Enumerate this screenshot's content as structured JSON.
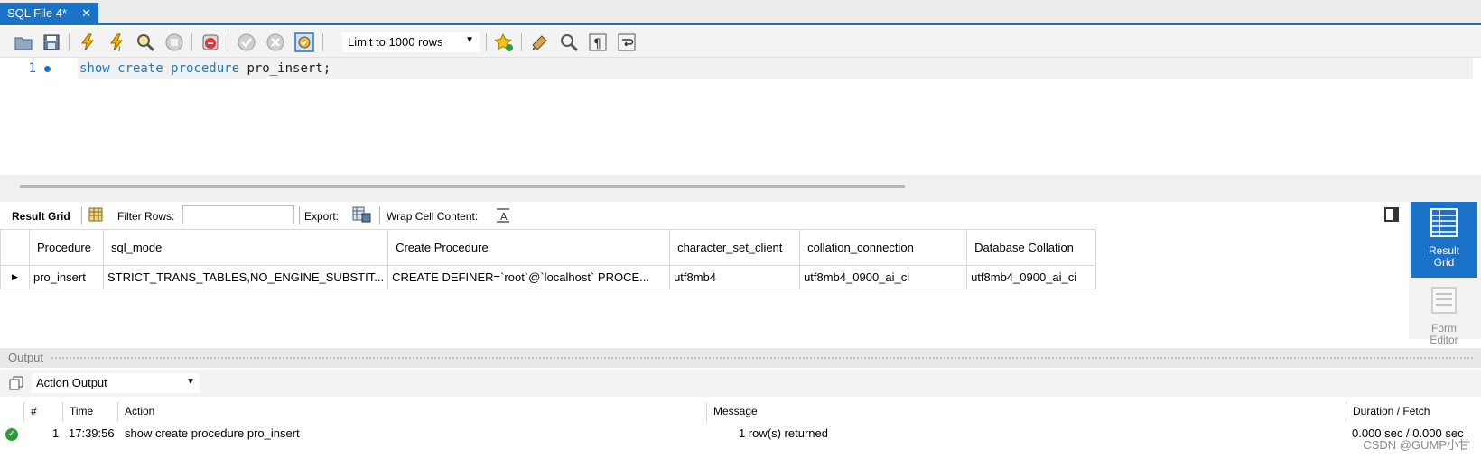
{
  "tab": {
    "title": "SQL File 4*",
    "close": "✕"
  },
  "toolbar": {
    "limit_select": "Limit to 1000 rows",
    "icons": [
      "open-file-icon",
      "save-icon",
      "execute-icon",
      "execute-selection-icon",
      "explain-icon",
      "stop-icon",
      "toggle-error-icon",
      "commit-icon",
      "rollback-icon",
      "autocommit-icon",
      "beautify-icon",
      "find-icon",
      "invisible-chars-icon",
      "word-wrap-icon",
      "bookmark-icon"
    ]
  },
  "editor": {
    "line_number": "1",
    "code_keywords": "show create procedure",
    "code_identifier": " pro_insert;"
  },
  "result_toolbar": {
    "result_grid": "Result Grid",
    "filter_rows": "Filter Rows:",
    "export": "Export:",
    "wrap_cell": "Wrap Cell Content:"
  },
  "grid": {
    "columns": [
      "Procedure",
      "sql_mode",
      "Create Procedure",
      "character_set_client",
      "collation_connection",
      "Database Collation"
    ],
    "rows": [
      [
        "pro_insert",
        "STRICT_TRANS_TABLES,NO_ENGINE_SUBSTIT...",
        "CREATE DEFINER=`root`@`localhost` PROCE...",
        "utf8mb4",
        "utf8mb4_0900_ai_ci",
        "utf8mb4_0900_ai_ci"
      ]
    ],
    "row_marker": "▶"
  },
  "side_panel": {
    "result_grid_label": "Result Grid",
    "form_editor_label": "Form Editor"
  },
  "output": {
    "header": "Output",
    "action_select": "Action Output",
    "columns": [
      "#",
      "Time",
      "Action",
      "Message",
      "Duration / Fetch"
    ],
    "row": {
      "num": "1",
      "time": "17:39:56",
      "action": "show create procedure pro_insert",
      "message": "1 row(s) returned",
      "duration": "0.000 sec / 0.000 sec"
    }
  },
  "watermark": "CSDN @GUMP小甘"
}
